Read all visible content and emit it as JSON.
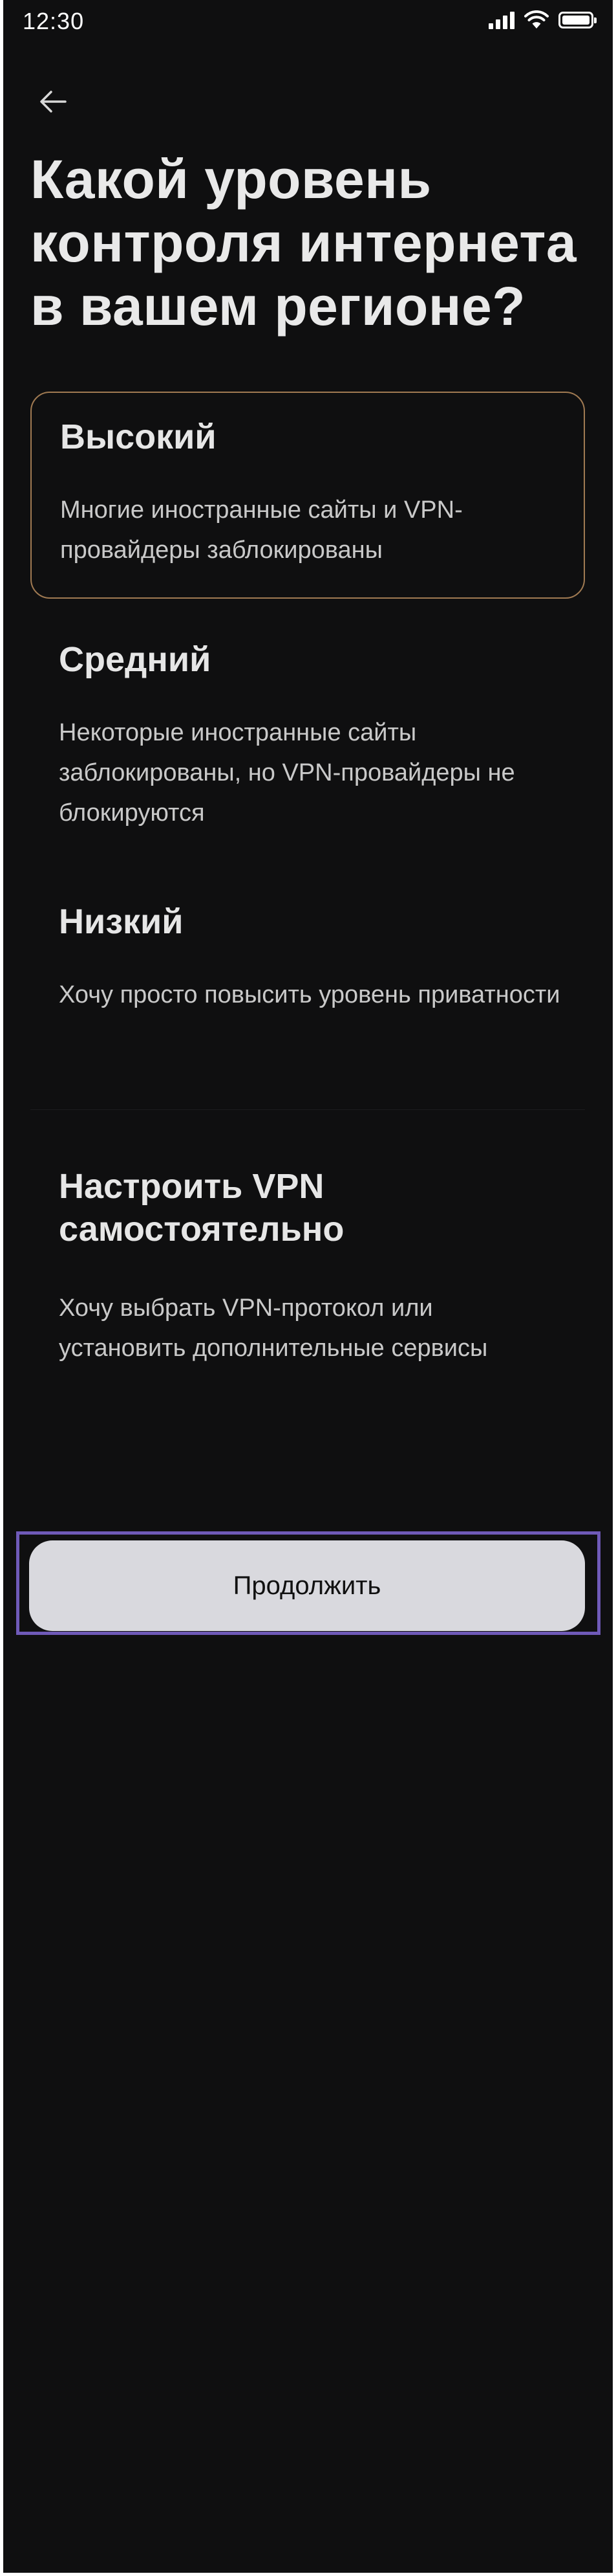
{
  "status_bar": {
    "time": "12:30",
    "icons": [
      "signal-icon",
      "wifi-icon",
      "battery-icon"
    ]
  },
  "header": {
    "back_icon": "arrow-left-icon",
    "title": "Какой уровень контроля интернета в вашем регионе?"
  },
  "options": [
    {
      "title": "Высокий",
      "description": "Многие иностранные сайты и VPN-провайдеры заблокированы",
      "selected": true
    },
    {
      "title": "Средний",
      "description": "Некоторые иностранные сайты заблокированы, но VPN-провайдеры не блокируются",
      "selected": false
    },
    {
      "title": "Низкий",
      "description": "Хочу просто повысить уровень приватности",
      "selected": false
    },
    {
      "title": "Настроить VPN самостоятельно",
      "description": "Хочу выбрать VPN-протокол или установить дополнительные сервисы",
      "selected": false
    }
  ],
  "footer": {
    "continue_label": "Продолжить"
  },
  "colors": {
    "background": "#0f0f10",
    "selected_border": "#a07a52",
    "button_background": "#d9d9de",
    "focus_outline": "#6f5ab8"
  }
}
